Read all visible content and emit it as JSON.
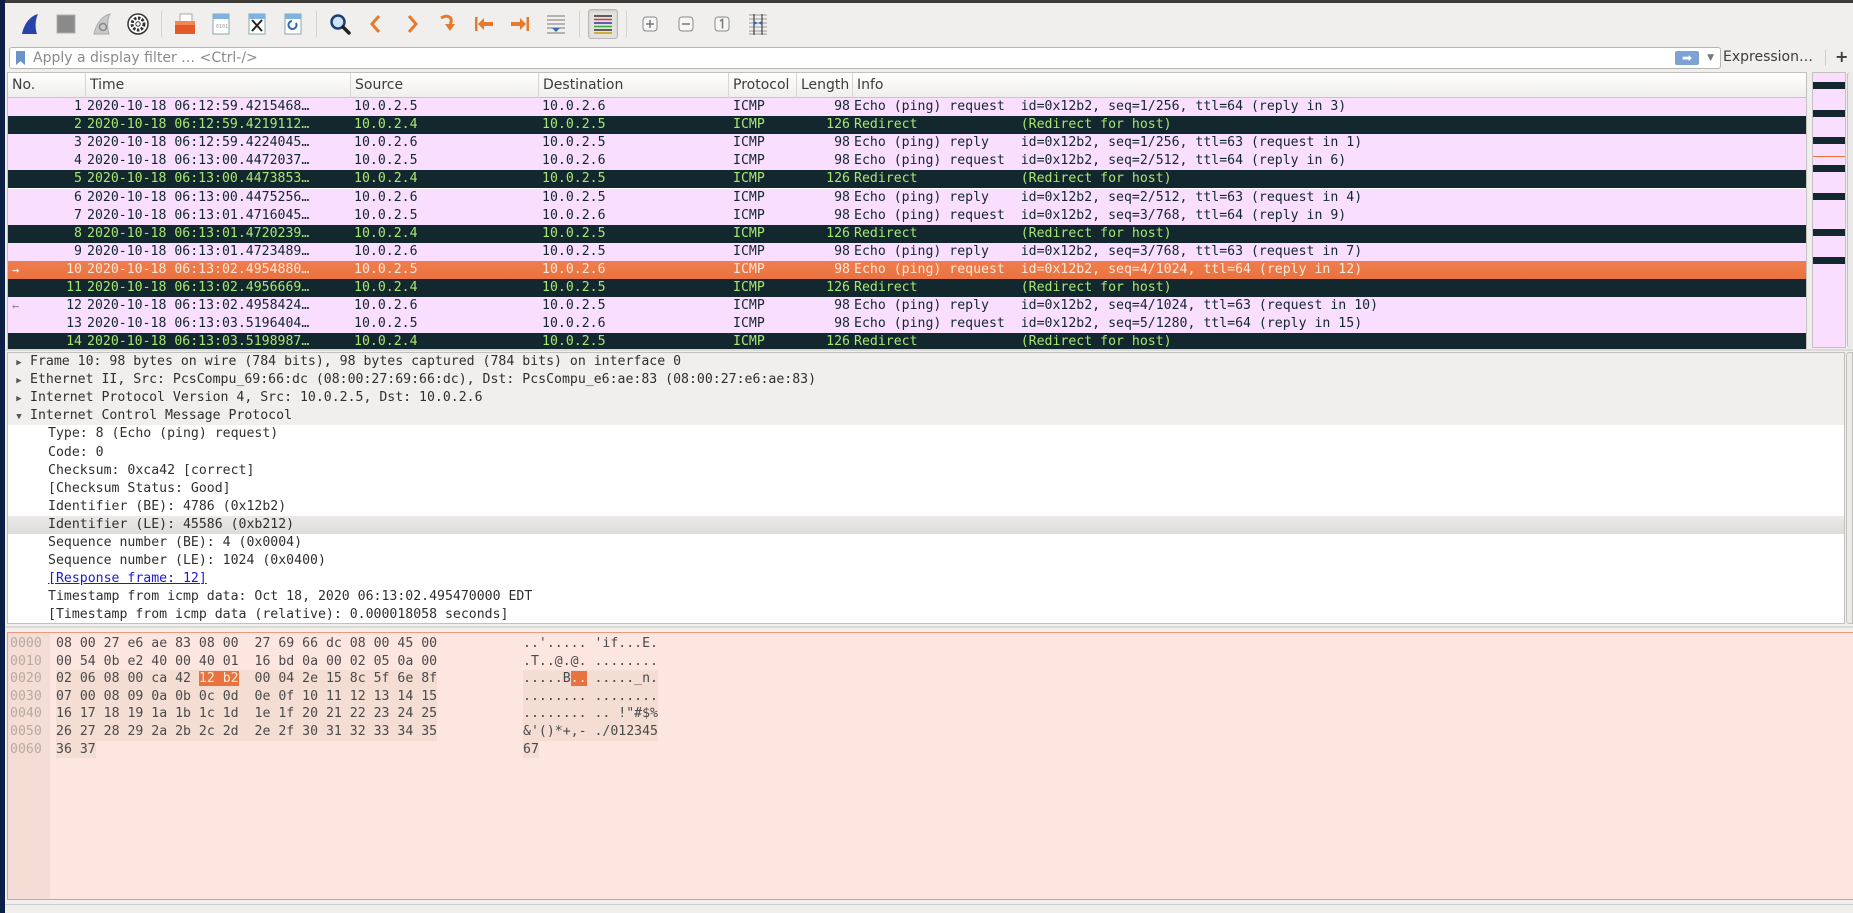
{
  "toolbar": {
    "buttons": [
      {
        "name": "start-capture-icon",
        "label": "Start capturing packets"
      },
      {
        "name": "stop-capture-icon",
        "label": "Stop capturing packets"
      },
      {
        "name": "restart-capture-icon",
        "label": "Restart capturing packets"
      },
      {
        "name": "capture-options-icon",
        "label": "Capture options"
      },
      {
        "name": "open-file-icon",
        "label": "Open"
      },
      {
        "name": "save-file-icon",
        "label": "Save"
      },
      {
        "name": "close-file-icon",
        "label": "Close"
      },
      {
        "name": "reload-file-icon",
        "label": "Reload"
      },
      {
        "name": "find-packet-icon",
        "label": "Find packet"
      },
      {
        "name": "go-back-icon",
        "label": "Go back"
      },
      {
        "name": "go-forward-icon",
        "label": "Go forward"
      },
      {
        "name": "go-to-packet-icon",
        "label": "Go to packet"
      },
      {
        "name": "go-first-packet-icon",
        "label": "First packet"
      },
      {
        "name": "go-last-packet-icon",
        "label": "Last packet"
      },
      {
        "name": "auto-scroll-icon",
        "label": "Auto scroll"
      },
      {
        "name": "colorize-icon",
        "label": "Colorize packet list"
      },
      {
        "name": "zoom-in-icon",
        "label": "Zoom in"
      },
      {
        "name": "zoom-out-icon",
        "label": "Zoom out"
      },
      {
        "name": "normal-size-icon",
        "label": "Normal size"
      },
      {
        "name": "resize-columns-icon",
        "label": "Resize columns"
      }
    ]
  },
  "filter": {
    "placeholder": "Apply a display filter … <Ctrl-/>",
    "value": "",
    "expression_label": "Expression…",
    "add_label": "+"
  },
  "colors": {
    "echo_bg": "#fadeff",
    "redirect_bg": "#12272e",
    "redirect_fg": "#a8e673",
    "selected_bg": "#e9733f"
  },
  "packet_list": {
    "columns": [
      "No.",
      "Time",
      "Source",
      "Destination",
      "Protocol",
      "Length",
      "Info"
    ],
    "rows": [
      {
        "no": "1",
        "time": "2020-10-18 06:12:59.4215468…",
        "src": "10.0.2.5",
        "dst": "10.0.2.6",
        "proto": "ICMP",
        "len": "98",
        "info": "Echo (ping) request  id=0x12b2, seq=1/256, ttl=64 (reply in 3)",
        "kind": "echo",
        "marker": ""
      },
      {
        "no": "2",
        "time": "2020-10-18 06:12:59.4219112…",
        "src": "10.0.2.4",
        "dst": "10.0.2.5",
        "proto": "ICMP",
        "len": "126",
        "info": "Redirect             (Redirect for host)",
        "kind": "redirect",
        "marker": ""
      },
      {
        "no": "3",
        "time": "2020-10-18 06:12:59.4224045…",
        "src": "10.0.2.6",
        "dst": "10.0.2.5",
        "proto": "ICMP",
        "len": "98",
        "info": "Echo (ping) reply    id=0x12b2, seq=1/256, ttl=63 (request in 1)",
        "kind": "echo",
        "marker": ""
      },
      {
        "no": "4",
        "time": "2020-10-18 06:13:00.4472037…",
        "src": "10.0.2.5",
        "dst": "10.0.2.6",
        "proto": "ICMP",
        "len": "98",
        "info": "Echo (ping) request  id=0x12b2, seq=2/512, ttl=64 (reply in 6)",
        "kind": "echo",
        "marker": ""
      },
      {
        "no": "5",
        "time": "2020-10-18 06:13:00.4473853…",
        "src": "10.0.2.4",
        "dst": "10.0.2.5",
        "proto": "ICMP",
        "len": "126",
        "info": "Redirect             (Redirect for host)",
        "kind": "redirect",
        "marker": ""
      },
      {
        "no": "6",
        "time": "2020-10-18 06:13:00.4475256…",
        "src": "10.0.2.6",
        "dst": "10.0.2.5",
        "proto": "ICMP",
        "len": "98",
        "info": "Echo (ping) reply    id=0x12b2, seq=2/512, ttl=63 (request in 4)",
        "kind": "echo",
        "marker": ""
      },
      {
        "no": "7",
        "time": "2020-10-18 06:13:01.4716045…",
        "src": "10.0.2.5",
        "dst": "10.0.2.6",
        "proto": "ICMP",
        "len": "98",
        "info": "Echo (ping) request  id=0x12b2, seq=3/768, ttl=64 (reply in 9)",
        "kind": "echo",
        "marker": ""
      },
      {
        "no": "8",
        "time": "2020-10-18 06:13:01.4720239…",
        "src": "10.0.2.4",
        "dst": "10.0.2.5",
        "proto": "ICMP",
        "len": "126",
        "info": "Redirect             (Redirect for host)",
        "kind": "redirect",
        "marker": ""
      },
      {
        "no": "9",
        "time": "2020-10-18 06:13:01.4723489…",
        "src": "10.0.2.6",
        "dst": "10.0.2.5",
        "proto": "ICMP",
        "len": "98",
        "info": "Echo (ping) reply    id=0x12b2, seq=3/768, ttl=63 (request in 7)",
        "kind": "echo",
        "marker": ""
      },
      {
        "no": "10",
        "time": "2020-10-18 06:13:02.4954880…",
        "src": "10.0.2.5",
        "dst": "10.0.2.6",
        "proto": "ICMP",
        "len": "98",
        "info": "Echo (ping) request  id=0x12b2, seq=4/1024, ttl=64 (reply in 12)",
        "kind": "selected",
        "marker": "→"
      },
      {
        "no": "11",
        "time": "2020-10-18 06:13:02.4956669…",
        "src": "10.0.2.4",
        "dst": "10.0.2.5",
        "proto": "ICMP",
        "len": "126",
        "info": "Redirect             (Redirect for host)",
        "kind": "redirect",
        "marker": ""
      },
      {
        "no": "12",
        "time": "2020-10-18 06:13:02.4958424…",
        "src": "10.0.2.6",
        "dst": "10.0.2.5",
        "proto": "ICMP",
        "len": "98",
        "info": "Echo (ping) reply    id=0x12b2, seq=4/1024, ttl=63 (request in 10)",
        "kind": "echo",
        "marker": "←"
      },
      {
        "no": "13",
        "time": "2020-10-18 06:13:03.5196404…",
        "src": "10.0.2.5",
        "dst": "10.0.2.6",
        "proto": "ICMP",
        "len": "98",
        "info": "Echo (ping) request  id=0x12b2, seq=5/1280, ttl=64 (reply in 15)",
        "kind": "echo",
        "marker": ""
      },
      {
        "no": "14",
        "time": "2020-10-18 06:13:03.5198987…",
        "src": "10.0.2.4",
        "dst": "10.0.2.5",
        "proto": "ICMP",
        "len": "126",
        "info": "Redirect             (Redirect for host)",
        "kind": "redirect",
        "marker": ""
      }
    ]
  },
  "details": {
    "rows": [
      {
        "text": "Frame 10: 98 bytes on wire (784 bits), 98 bytes captured (784 bits) on interface 0",
        "level": 0,
        "expander": "collapsed",
        "style": "header"
      },
      {
        "text": "Ethernet II, Src: PcsCompu_69:66:dc (08:00:27:69:66:dc), Dst: PcsCompu_e6:ae:83 (08:00:27:e6:ae:83)",
        "level": 0,
        "expander": "collapsed",
        "style": "header"
      },
      {
        "text": "Internet Protocol Version 4, Src: 10.0.2.5, Dst: 10.0.2.6",
        "level": 0,
        "expander": "collapsed",
        "style": "header"
      },
      {
        "text": "Internet Control Message Protocol",
        "level": 0,
        "expander": "expanded",
        "style": "header"
      },
      {
        "text": "Type: 8 (Echo (ping) request)",
        "level": 1,
        "expander": "",
        "style": ""
      },
      {
        "text": "Code: 0",
        "level": 1,
        "expander": "",
        "style": ""
      },
      {
        "text": "Checksum: 0xca42 [correct]",
        "level": 1,
        "expander": "",
        "style": ""
      },
      {
        "text": "[Checksum Status: Good]",
        "level": 1,
        "expander": "",
        "style": ""
      },
      {
        "text": "Identifier (BE): 4786 (0x12b2)",
        "level": 1,
        "expander": "",
        "style": ""
      },
      {
        "text": "Identifier (LE): 45586 (0xb212)",
        "level": 1,
        "expander": "",
        "style": "selected"
      },
      {
        "text": "Sequence number (BE): 4 (0x0004)",
        "level": 1,
        "expander": "",
        "style": ""
      },
      {
        "text": "Sequence number (LE): 1024 (0x0400)",
        "level": 1,
        "expander": "",
        "style": ""
      },
      {
        "text": "[Response frame: 12]",
        "level": 1,
        "expander": "",
        "style": "link"
      },
      {
        "text": "Timestamp from icmp data: Oct 18, 2020 06:13:02.495470000 EDT",
        "level": 1,
        "expander": "",
        "style": ""
      },
      {
        "text": "[Timestamp from icmp data (relative): 0.000018058 seconds]",
        "level": 1,
        "expander": "",
        "style": ""
      }
    ]
  },
  "bytes": {
    "rows": [
      {
        "offset": "0000",
        "hex_a": "08 00 27 e6 ae 83 08 00",
        "hex_b": "27 69 66 dc 08 00 45 00",
        "ascii_a": "..'.....",
        "ascii_b": "'if...E."
      },
      {
        "offset": "0010",
        "hex_a": "00 54 0b e2 40 00 40 01",
        "hex_b": "16 bd 0a 00 02 05 0a 00",
        "ascii_a": ".T..@.@.",
        "ascii_b": "........"
      },
      {
        "offset": "0020",
        "hex_a": "02 06 08 00 ca 42 12 b2",
        "hex_b": "00 04 2e 15 8c 5f 6e 8f",
        "ascii_a": ".....B..",
        "ascii_b": "....._n."
      },
      {
        "offset": "0030",
        "hex_a": "07 00 08 09 0a 0b 0c 0d",
        "hex_b": "0e 0f 10 11 12 13 14 15",
        "ascii_a": "........",
        "ascii_b": "........"
      },
      {
        "offset": "0040",
        "hex_a": "16 17 18 19 1a 1b 1c 1d",
        "hex_b": "1e 1f 20 21 22 23 24 25",
        "ascii_a": "........",
        "ascii_b": ".. !\"#$%"
      },
      {
        "offset": "0050",
        "hex_a": "26 27 28 29 2a 2b 2c 2d",
        "hex_b": "2e 2f 30 31 32 33 34 35",
        "ascii_a": "&'()*+,-",
        "ascii_b": "./012345"
      },
      {
        "offset": "0060",
        "hex_a": "36 37",
        "hex_b": "",
        "ascii_a": "67",
        "ascii_b": ""
      }
    ],
    "highlight": {
      "row": 2,
      "hex": "12 b2",
      "ascii": ".."
    }
  }
}
